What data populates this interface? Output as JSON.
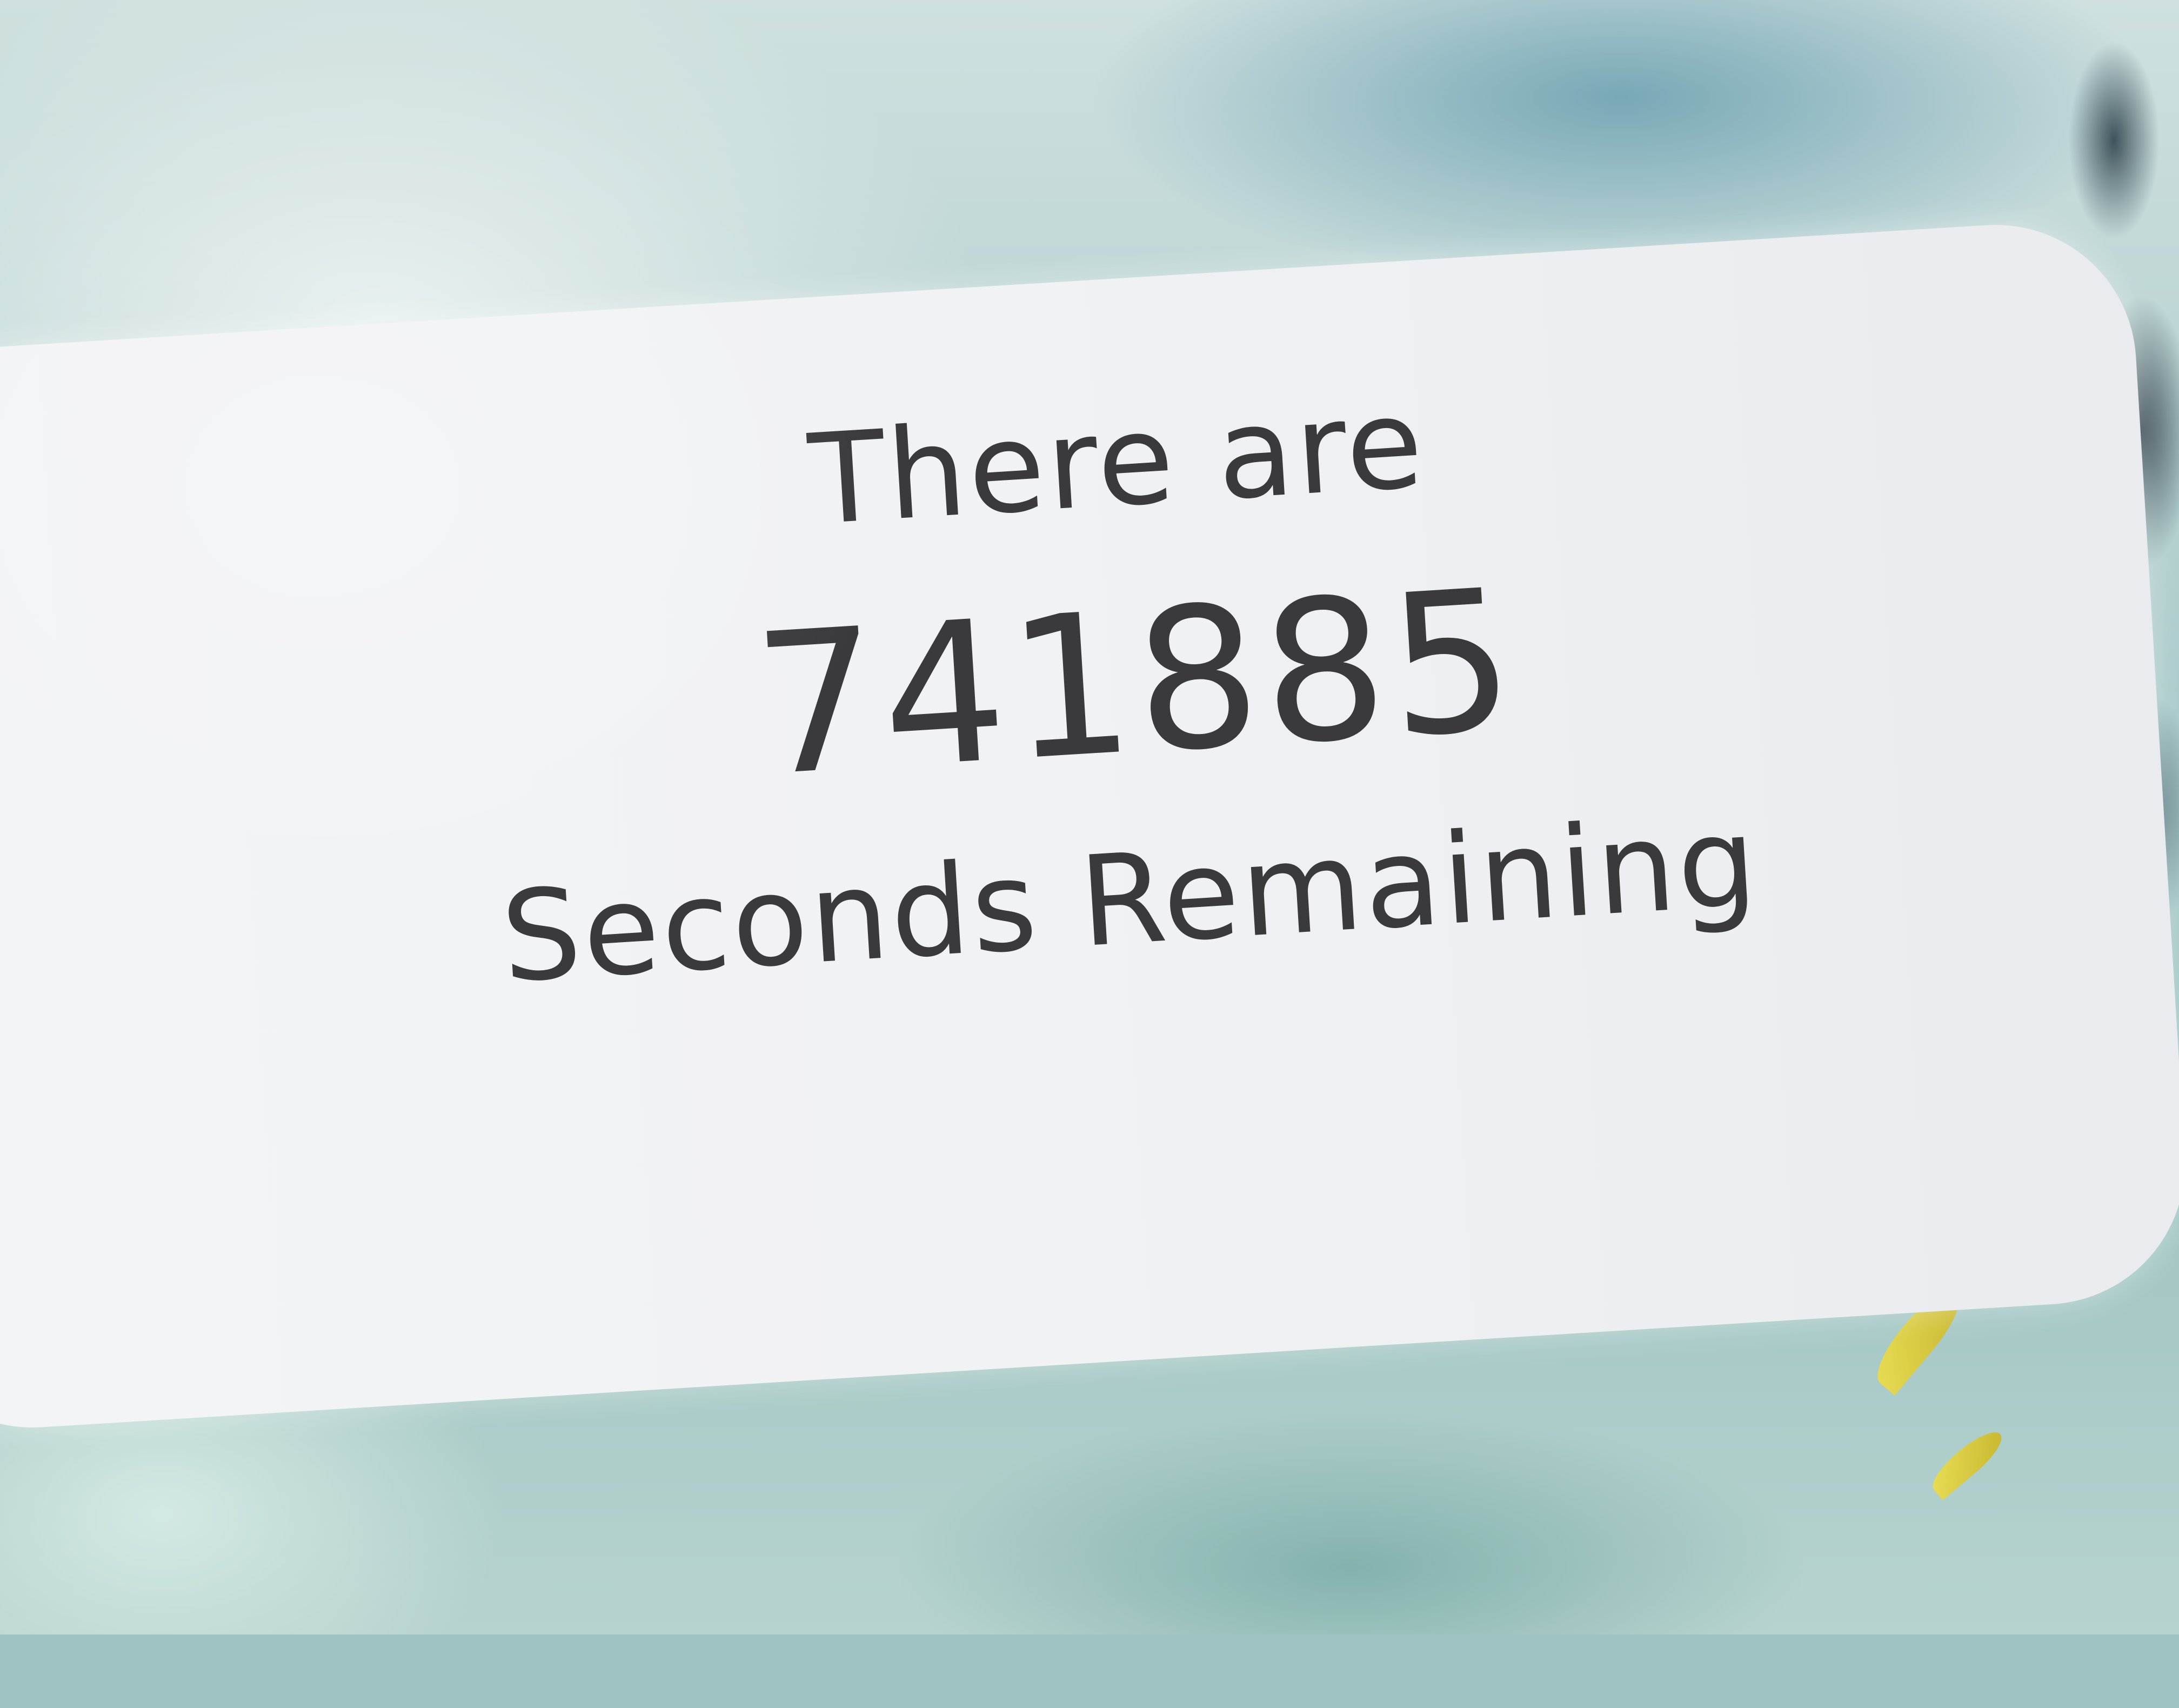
{
  "countdown": {
    "intro": "There are",
    "value": "741885",
    "outro": "Seconds Remaining"
  }
}
